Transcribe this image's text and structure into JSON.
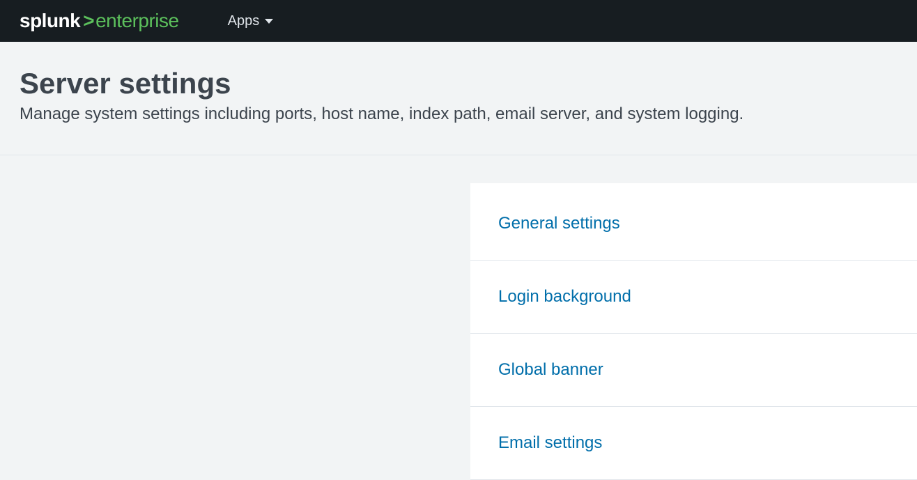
{
  "brand": {
    "primary": "splunk",
    "secondary": "enterprise"
  },
  "nav": {
    "apps_label": "Apps"
  },
  "page": {
    "title": "Server settings",
    "subtitle": "Manage system settings including ports, host name, index path, email server, and system logging."
  },
  "settings_links": [
    {
      "label": "General settings"
    },
    {
      "label": "Login background"
    },
    {
      "label": "Global banner"
    },
    {
      "label": "Email settings"
    }
  ]
}
